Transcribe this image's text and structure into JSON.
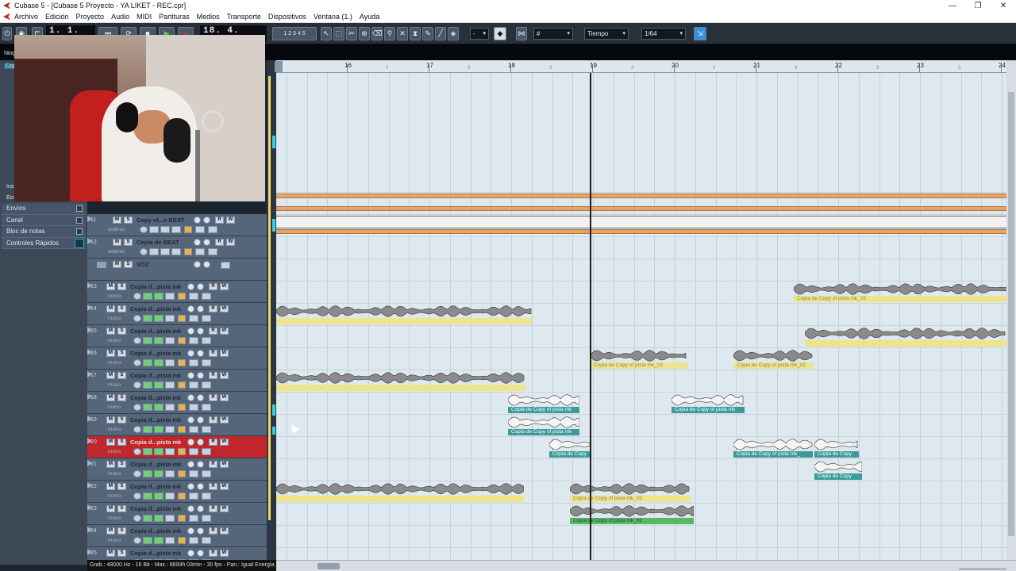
{
  "window": {
    "title": "Cubase 5 - [Cubase 5 Proyecto - YA LIKET - REC.cpr]",
    "controls": [
      "—",
      "❐",
      "✕"
    ]
  },
  "menu": [
    "Archivo",
    "Edición",
    "Proyecto",
    "Audio",
    "MIDI",
    "Partituras",
    "Medios",
    "Transporte",
    "Dispositivos",
    "Ventana (1.)",
    "Ayuda"
  ],
  "toolbar": {
    "position_left": "1. 1. 1. 0",
    "position_right": "18. 4. 4.111",
    "grid_mode": "Tiempo",
    "quantize": "1/64",
    "snap_value": "-"
  },
  "inspector": {
    "rows": [
      "Envíos",
      "Canal",
      "Bloc de notas",
      "Controles Rápidos"
    ],
    "partial_labels": [
      "Ins",
      "Ecu",
      "Ning",
      "Cop"
    ]
  },
  "ruler": {
    "bars": [
      "16",
      "17",
      "18",
      "19",
      "20",
      "21",
      "22",
      "23",
      "24"
    ],
    "sub_label": "3"
  },
  "tracks": [
    {
      "num": "11",
      "name": "Copy of...e BEAT",
      "mode": "estéreo"
    },
    {
      "num": "12",
      "name": "Copia de BEAT",
      "mode": "estéreo"
    },
    {
      "num": "",
      "name": "VOZ",
      "mode": ""
    },
    {
      "num": "13",
      "name": "Copia d...pista mk",
      "mode": "mono"
    },
    {
      "num": "14",
      "name": "Copia d...pista mk",
      "mode": "mono"
    },
    {
      "num": "15",
      "name": "Copia d...pista mk",
      "mode": "mono"
    },
    {
      "num": "16",
      "name": "Copia d...pista mk",
      "mode": "mono"
    },
    {
      "num": "17",
      "name": "Copia d...pista mk",
      "mode": "mono"
    },
    {
      "num": "18",
      "name": "Copia d...pista mk",
      "mode": "mono"
    },
    {
      "num": "19",
      "name": "Copia d...pista mk",
      "mode": "mono"
    },
    {
      "num": "20",
      "name": "Copia d...pista mk",
      "mode": "mono",
      "selected": true
    },
    {
      "num": "21",
      "name": "Copia d...pista mk",
      "mode": "mono"
    },
    {
      "num": "22",
      "name": "Copia d...pista mk",
      "mode": "mono"
    },
    {
      "num": "23",
      "name": "Copia d...pista mk",
      "mode": "mono"
    },
    {
      "num": "24",
      "name": "Copia d...pista mk",
      "mode": "mono"
    },
    {
      "num": "25",
      "name": "Copia d...pista mk",
      "mode": "mono"
    }
  ],
  "events": {
    "t13": "Copia de Copy of pista mk_02",
    "t18a": "Copia de Copy of pista mk",
    "t18b": "Copia de Copy of pista mk",
    "t19": "Copia de Copy of pista mk",
    "t20a": "Copia de Copy",
    "t20b": "Copia de Copy of pista mk_",
    "t20c": "Copia de Copy",
    "t16a": "Copia de Copy of pista mk_02",
    "t16b": "Copia de Copy of pista mk_02",
    "t22": "Copia de Copy of pista mk_02",
    "t23": "Copia de Copy of pista mk_02",
    "t21": "Copia de Copy"
  },
  "status": "Grab.: 48000 Hz - 16 Bit - Max.: 8699h 03min - 30 fps - Pan.: Igual Energía",
  "colors": {
    "selected_track": "#c0272c",
    "event_yellow": "#eee48a",
    "event_teal": "#3c9b98",
    "event_green": "#58b860",
    "beat_band": "#e5a569",
    "arrange_bg": "#dee8ef"
  }
}
